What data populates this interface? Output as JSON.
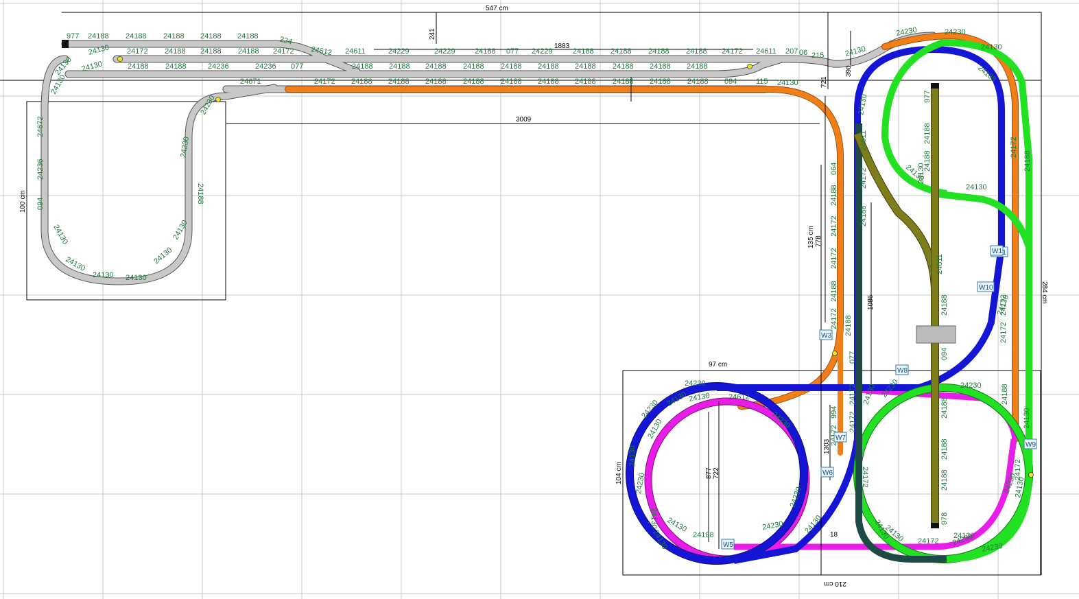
{
  "colors": {
    "grid": "#c9c9c9",
    "track_gray": "#c8c8c8",
    "track_orange": "#f07f1a",
    "track_blue": "#1515d6",
    "track_magenta": "#e81ee8",
    "track_green": "#22e022",
    "track_olive": "#7d7d1c",
    "track_teal": "#1d4a45",
    "label_green": "#1f7a3a"
  },
  "dimensions": {
    "width_total": "547 cm",
    "height_right": "284 cm",
    "left_board_height": "100 cm",
    "lower_board_width": "97 cm",
    "lower_board_height": "104 cm",
    "right_bottom": "210 cm",
    "mid_vertical": "135 cm",
    "run_1883": "1883",
    "run_3009": "3009",
    "v_241": "241",
    "v_390": "390",
    "v_721": "721",
    "v_778": "778",
    "v_1303": "1303",
    "v_1086": "1086",
    "v_722": "722",
    "v_877": "877",
    "v_18": "18"
  },
  "turnouts": [
    "W1",
    "W3",
    "W5",
    "W6",
    "W7",
    "W8",
    "W9",
    "W10",
    "W11"
  ],
  "part_labels": {
    "row1": [
      "977",
      "24188",
      "24188",
      "24188",
      "24188",
      "24188",
      "224"
    ],
    "row2": [
      "24130",
      "24172",
      "24188",
      "24188",
      "24188",
      "24172",
      "24612",
      "24611",
      "24229",
      "24229",
      "24188",
      "077",
      "24229",
      "24188",
      "24188",
      "24188",
      "24188",
      "24172",
      "24611",
      "207",
      "06",
      "215",
      "24130",
      "24230",
      "24230"
    ],
    "row3": [
      "24130",
      "24188",
      "24188",
      "24236",
      "24236",
      "077",
      "24188",
      "24188",
      "24188",
      "24188",
      "24188",
      "24188",
      "24188",
      "24188",
      "24188",
      "24188"
    ],
    "row4": [
      "24671",
      "24172",
      "24188",
      "24188",
      "24188",
      "24188",
      "24188",
      "24188",
      "24188",
      "24188",
      "24188",
      "24188",
      "094",
      "115",
      "24130"
    ],
    "left_loop": [
      "24130",
      "24130",
      "24672",
      "24236",
      "094",
      "24130",
      "24130",
      "24130",
      "24130",
      "24130",
      "24130",
      "24230",
      "24188",
      "24230"
    ],
    "orange_vertical": [
      "064",
      "24188",
      "24172",
      "24172",
      "24188",
      "24172",
      "24188",
      "994",
      "24172"
    ],
    "teal_vertical": [
      "24611",
      "24172",
      "24188",
      "077",
      "24172",
      "24172"
    ],
    "olive_spur": [
      "977",
      "24188",
      "24188",
      "24611",
      "24188",
      "094",
      "24188",
      "24188",
      "24188",
      "978"
    ],
    "lower_left_loops": [
      "24230",
      "24130",
      "24612",
      "24230",
      "24130",
      "24230",
      "24130",
      "24130",
      "24230",
      "24130",
      "24130",
      "24130",
      "24188",
      "24230",
      "24130",
      "24230"
    ],
    "right_loops": [
      "24230",
      "24130",
      "24172",
      "24130",
      "24130",
      "24230",
      "24172",
      "24130",
      "24230",
      "24188",
      "24130",
      "24130",
      "24230",
      "24172",
      "24130",
      "24230"
    ],
    "blue_green": [
      "24130",
      "24130",
      "24130",
      "24130",
      "24130",
      "24188",
      "24172",
      "24188",
      "24172",
      "24172"
    ]
  }
}
